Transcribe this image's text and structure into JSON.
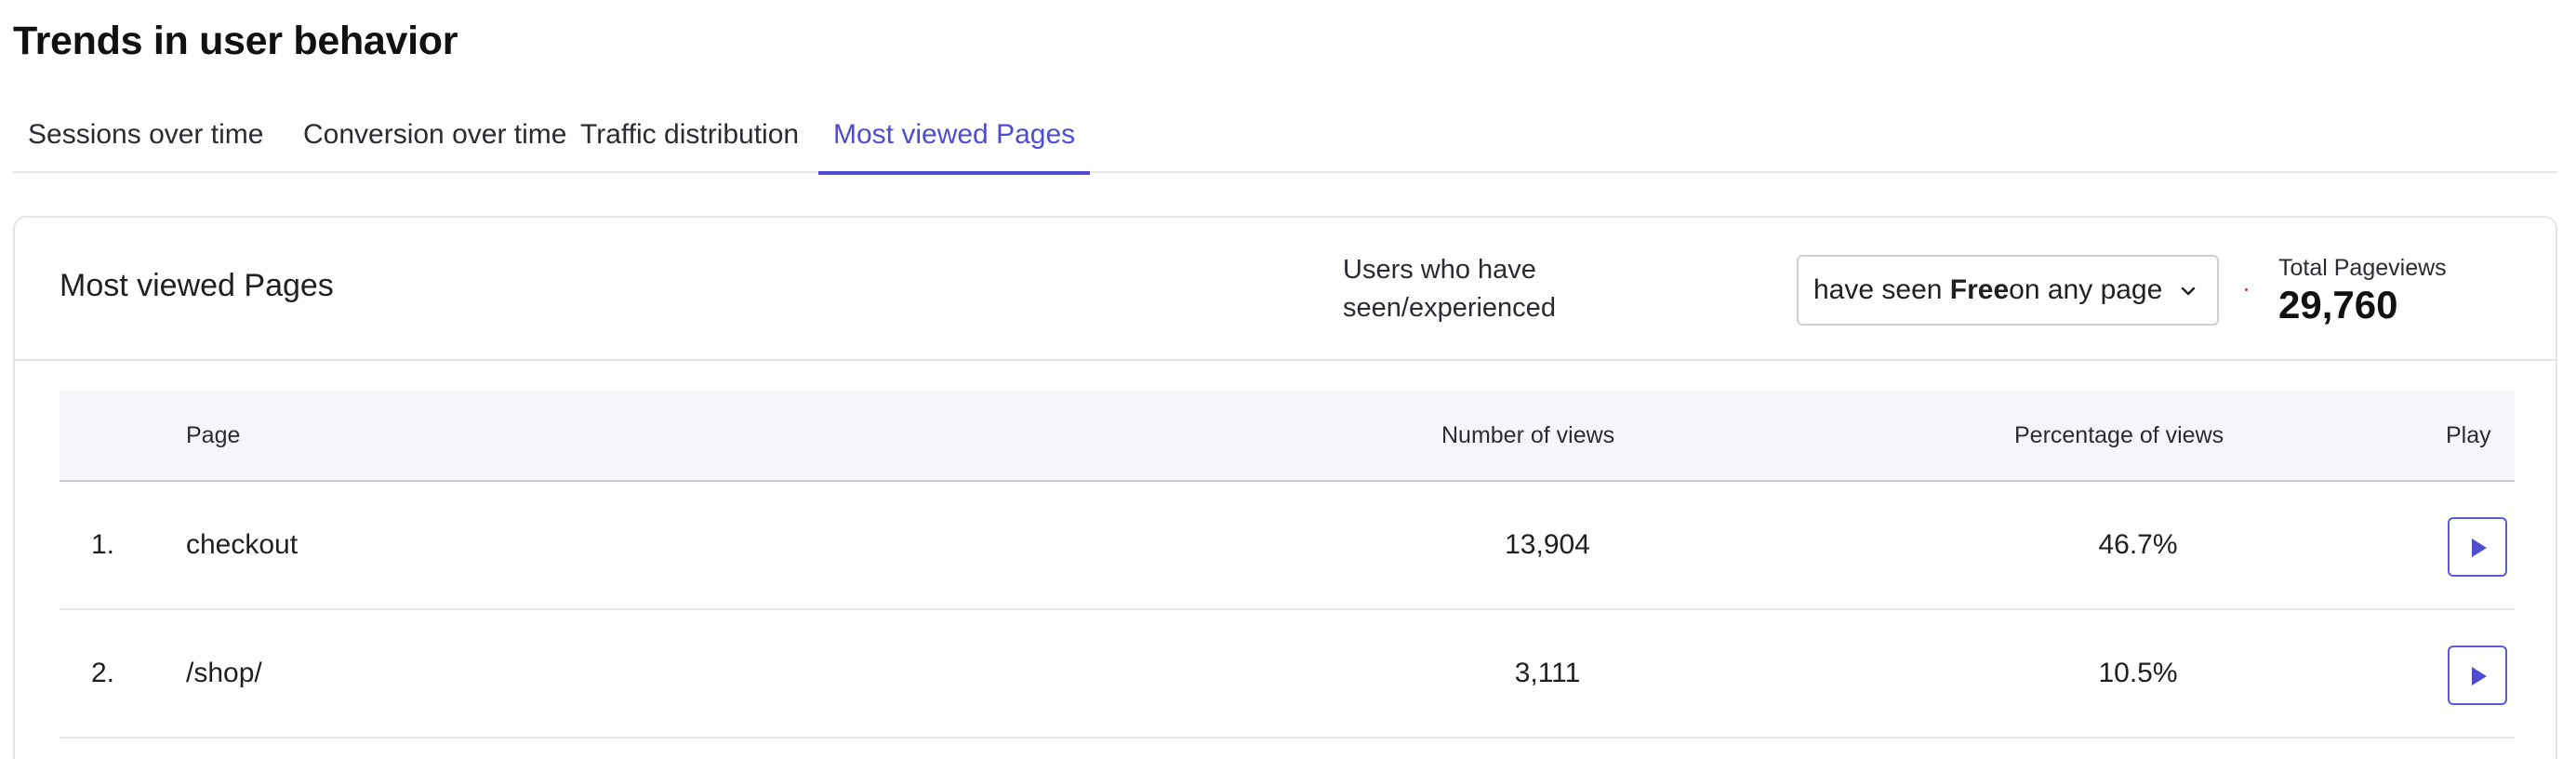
{
  "page_title": "Trends in user behavior",
  "tabs": [
    {
      "label": "Sessions over time"
    },
    {
      "label": "Conversion over time"
    },
    {
      "label": "Traffic distribution"
    },
    {
      "label": "Most viewed Pages"
    }
  ],
  "active_tab": "Most viewed Pages",
  "accent_color": "#4f4cd0",
  "card": {
    "title": "Most viewed Pages",
    "filter_label": "Users who have seen/experienced",
    "filter_select": {
      "prefix": "have seen ",
      "bold": "Free",
      "suffix": "on any page"
    },
    "kpi": {
      "label": "Total Pageviews",
      "value": "29,760"
    }
  },
  "table": {
    "headers": {
      "page": "Page",
      "views": "Number of views",
      "percentage": "Percentage of views",
      "play": "Play"
    },
    "rows": [
      {
        "rank": "1.",
        "page": "checkout",
        "views": "13,904",
        "percentage": "46.7%"
      },
      {
        "rank": "2.",
        "page": "/shop/",
        "views": "3,111",
        "percentage": "10.5%"
      }
    ]
  },
  "icons": {
    "select_chevron": "chevron-down-icon",
    "play": "play-icon"
  }
}
